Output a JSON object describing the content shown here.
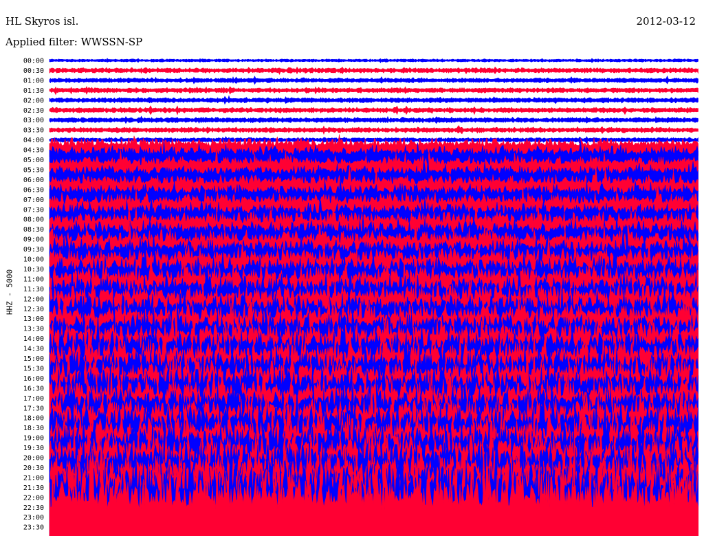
{
  "header": {
    "station": "HL Skyros isl.",
    "date": "2012-03-12",
    "filter": "Applied filter: WWSSN-SP"
  },
  "chart_data": {
    "type": "line",
    "title": "HL Skyros isl.",
    "subtitle": "Applied filter: WWSSN-SP",
    "date": "2012-03-12",
    "ylabel": "HHZ - 5000",
    "xlabel": "",
    "tick_labels": [
      "00:00",
      "00:30",
      "01:00",
      "01:30",
      "02:00",
      "02:30",
      "03:00",
      "03:30",
      "04:00",
      "04:30",
      "05:00",
      "05:30",
      "06:00",
      "06:30",
      "07:00",
      "07:30",
      "08:00",
      "08:30",
      "09:00",
      "09:30",
      "10:00",
      "10:30",
      "11:00",
      "11:30",
      "12:00",
      "12:30",
      "13:00",
      "13:30",
      "14:00",
      "14:30",
      "15:00",
      "15:30",
      "16:00",
      "16:30",
      "17:00",
      "17:30",
      "18:00",
      "18:30",
      "19:00",
      "19:30",
      "20:00",
      "20:30",
      "21:00",
      "21:30",
      "22:00",
      "22:30",
      "23:00",
      "23:30"
    ],
    "trace_colors": [
      "#0000ff",
      "#ff0033"
    ],
    "trace_amplitude_level": [
      0.35,
      0.6,
      0.55,
      0.6,
      0.6,
      0.6,
      0.6,
      0.6,
      0.55,
      2.5,
      3.0,
      3.0,
      3.2,
      3.2,
      3.3,
      3.5,
      3.6,
      3.8,
      4.0,
      4.2,
      4.5,
      4.6,
      4.8,
      5.0,
      5.0,
      5.2,
      5.3,
      5.5,
      5.6,
      5.8,
      6.0,
      6.0,
      6.2,
      6.3,
      6.5,
      6.5,
      6.6,
      6.8,
      7.0,
      7.0,
      7.2,
      7.4,
      7.5,
      7.5,
      8.0,
      12,
      12,
      12
    ],
    "grid": false
  }
}
